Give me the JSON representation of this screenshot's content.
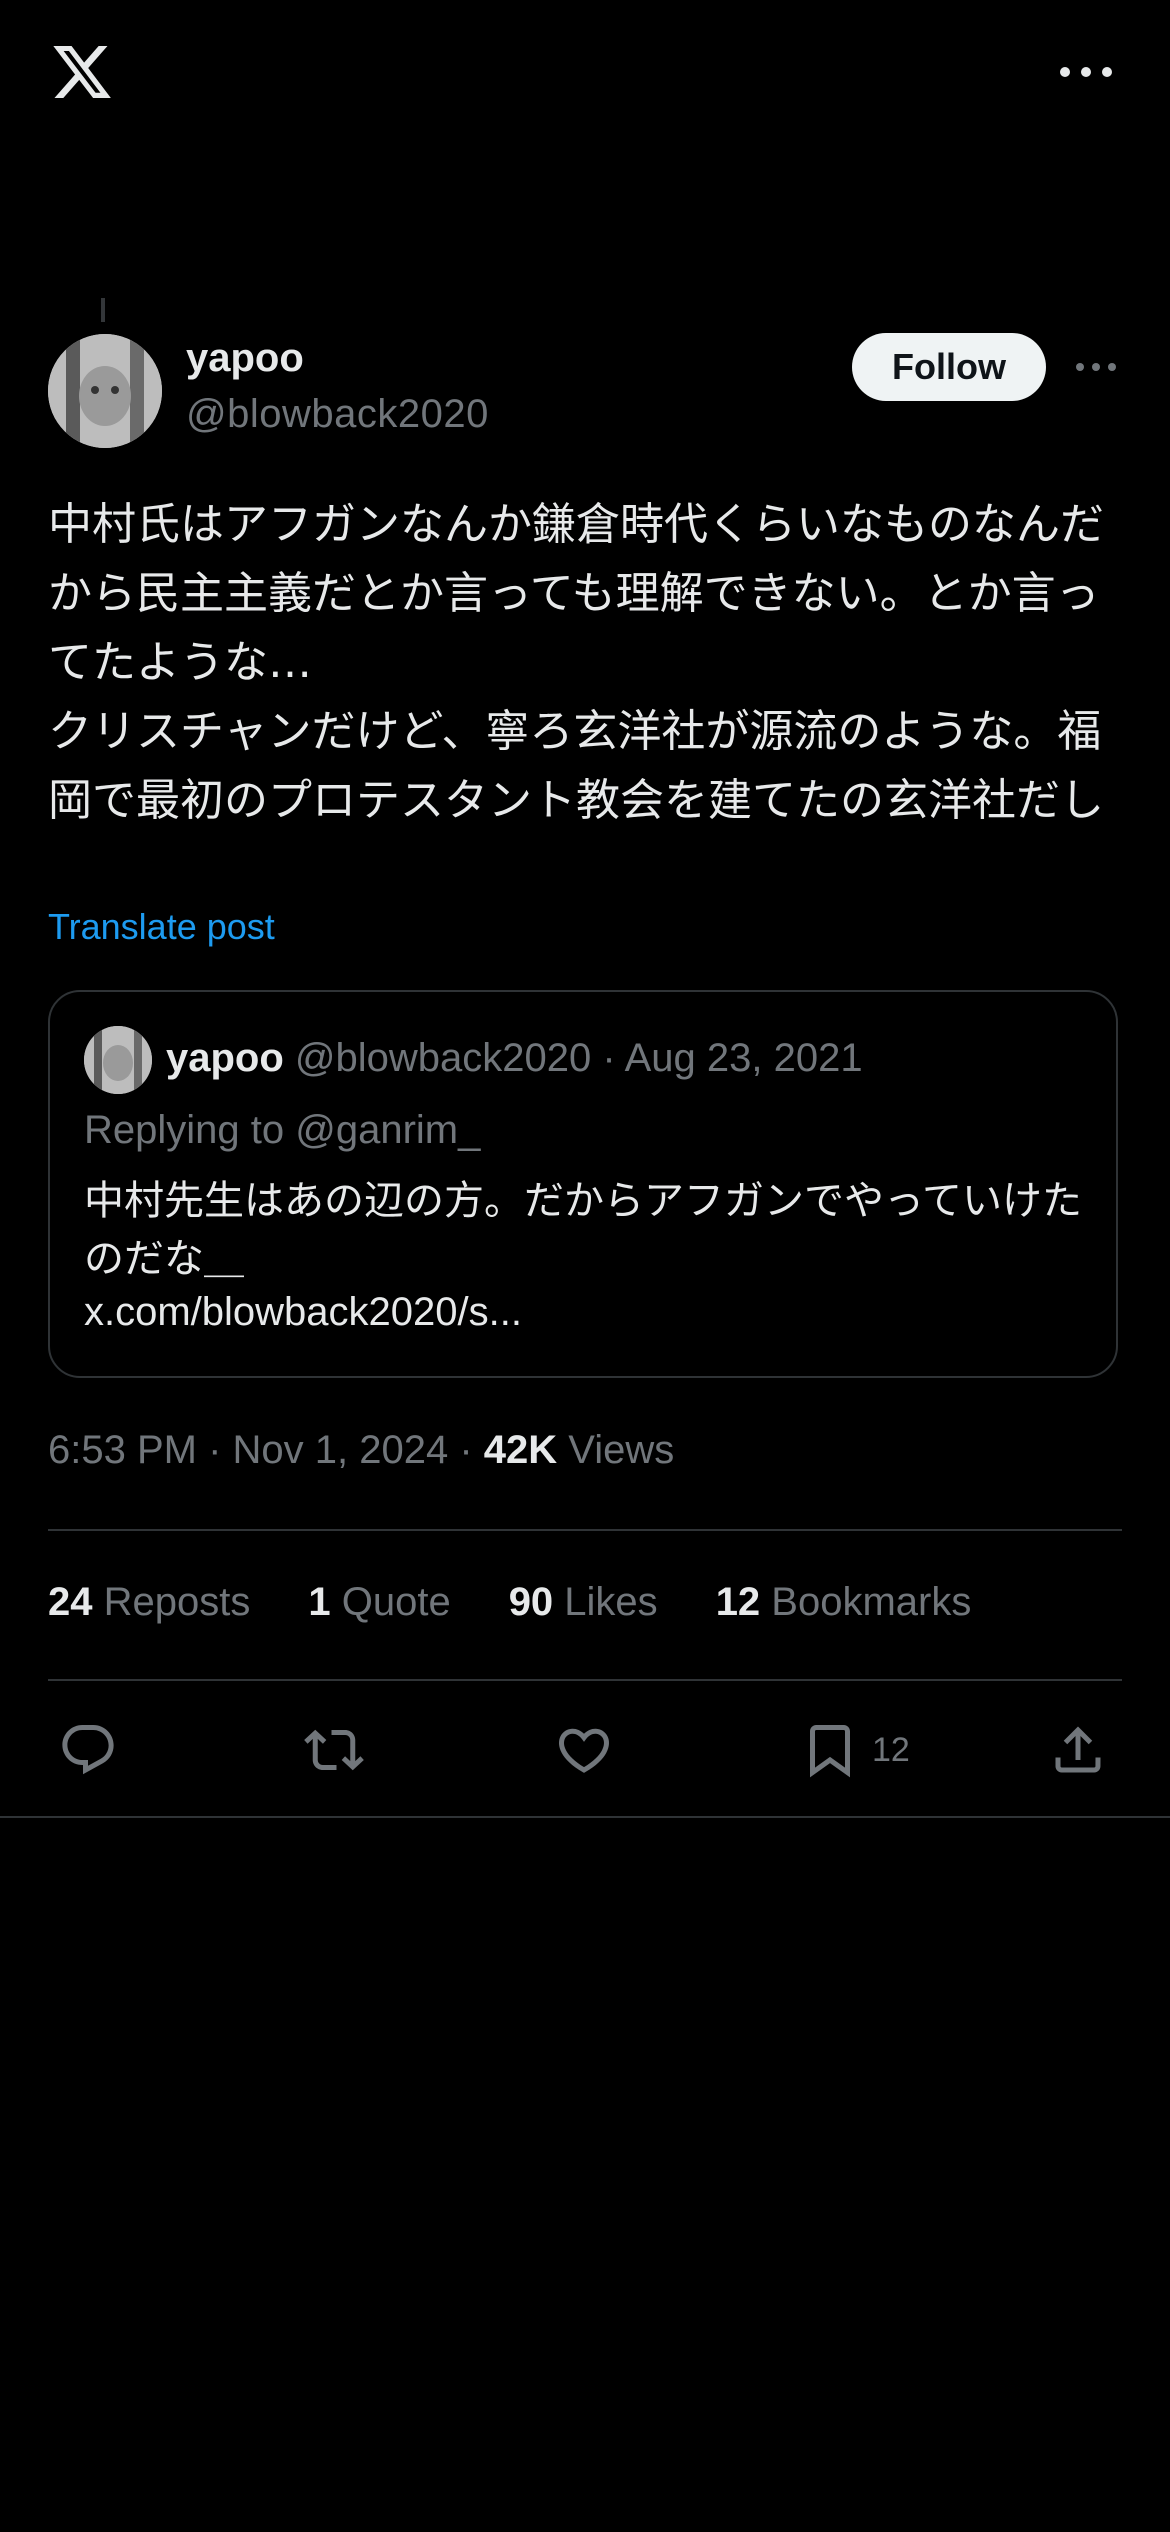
{
  "post": {
    "display_name": "yapoo",
    "handle": "@blowback2020",
    "follow_label": "Follow",
    "text": "中村氏はアフガンなんか鎌倉時代くらいなものなんだから民主主義だとか言っても理解できない。とか言ってたような…\nクリスチャンだけど、寧ろ玄洋社が源流のような。福岡で最初のプロテスタント教会を建てたの玄洋社だし",
    "translate_label": "Translate post",
    "time": "6:53 PM · Nov 1, 2024 · ",
    "views_count": "42K",
    "views_label": " Views"
  },
  "quoted": {
    "display_name": "yapoo",
    "meta": " @blowback2020 · Aug 23, 2021",
    "replying_to": "Replying to @ganrim_",
    "text": "中村先生はあの辺の方。だからアフガンでやっていけたのだな＿",
    "link": "x.com/blowback2020/s..."
  },
  "stats": {
    "reposts_count": "24",
    "reposts_label": " Reposts",
    "quote_count": "1",
    "quote_label": " Quote",
    "likes_count": "90",
    "likes_label": " Likes",
    "bookmarks_count": "12",
    "bookmarks_label": " Bookmarks"
  },
  "actions": {
    "bookmark_count": "12"
  },
  "icons": [
    "x-logo-icon",
    "more-icon",
    "reply-icon",
    "repost-icon",
    "like-icon",
    "bookmark-icon",
    "share-icon"
  ],
  "colors": {
    "background": "#000000",
    "text": "#e7e9ea",
    "secondary": "#71767b",
    "link": "#1d9bf0",
    "border": "#2f3336"
  }
}
